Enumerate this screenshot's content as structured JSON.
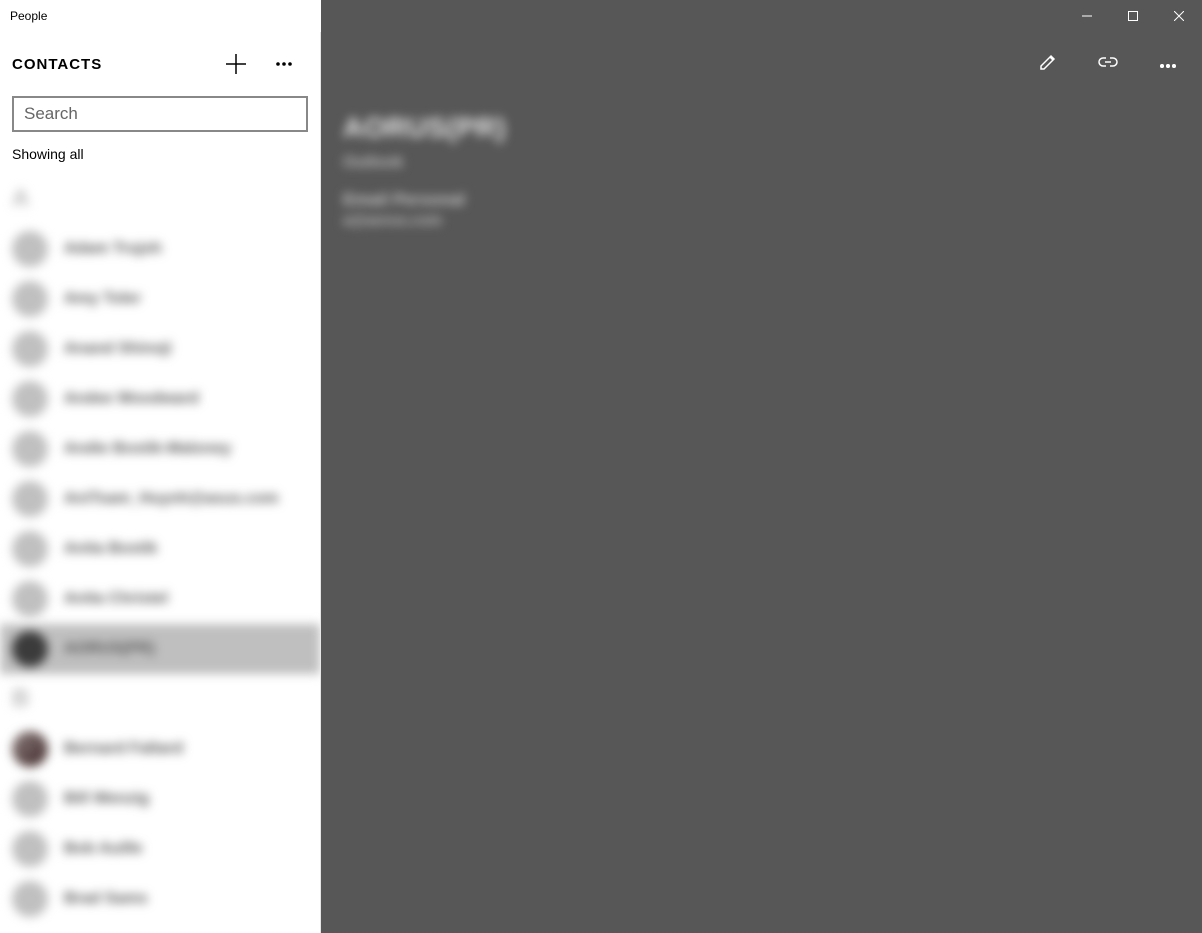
{
  "window": {
    "title": "People"
  },
  "sidebar": {
    "header": "CONTACTS",
    "search_placeholder": "Search",
    "showing": "Showing all",
    "groups": [
      {
        "letter": "A",
        "items": [
          {
            "name": "Adam Trujoh",
            "selected": false,
            "avatar": "std"
          },
          {
            "name": "Amy Toler",
            "selected": false,
            "avatar": "std"
          },
          {
            "name": "Anand Shinoji",
            "selected": false,
            "avatar": "std"
          },
          {
            "name": "Andee Woodward",
            "selected": false,
            "avatar": "std"
          },
          {
            "name": "Andie Bostik-Maloney",
            "selected": false,
            "avatar": "std"
          },
          {
            "name": "AniTsam_Huynh@asus.com",
            "selected": false,
            "avatar": "std"
          },
          {
            "name": "Anita Bostik",
            "selected": false,
            "avatar": "std"
          },
          {
            "name": "Anita Christel",
            "selected": false,
            "avatar": "std"
          },
          {
            "name": "AORUS(PR)",
            "selected": true,
            "avatar": "dark"
          }
        ]
      },
      {
        "letter": "B",
        "items": [
          {
            "name": "Bernard Faltard",
            "selected": false,
            "avatar": "photo"
          },
          {
            "name": "Bill Wenzig",
            "selected": false,
            "avatar": "std"
          },
          {
            "name": "Bob Auille",
            "selected": false,
            "avatar": "std"
          },
          {
            "name": "Brad Sams",
            "selected": false,
            "avatar": "std"
          }
        ]
      }
    ]
  },
  "detail": {
    "name": "AORUS(PR)",
    "account": "Outlook",
    "fields": [
      {
        "label": "Email Personal",
        "value": "a@aorus.com"
      }
    ]
  }
}
